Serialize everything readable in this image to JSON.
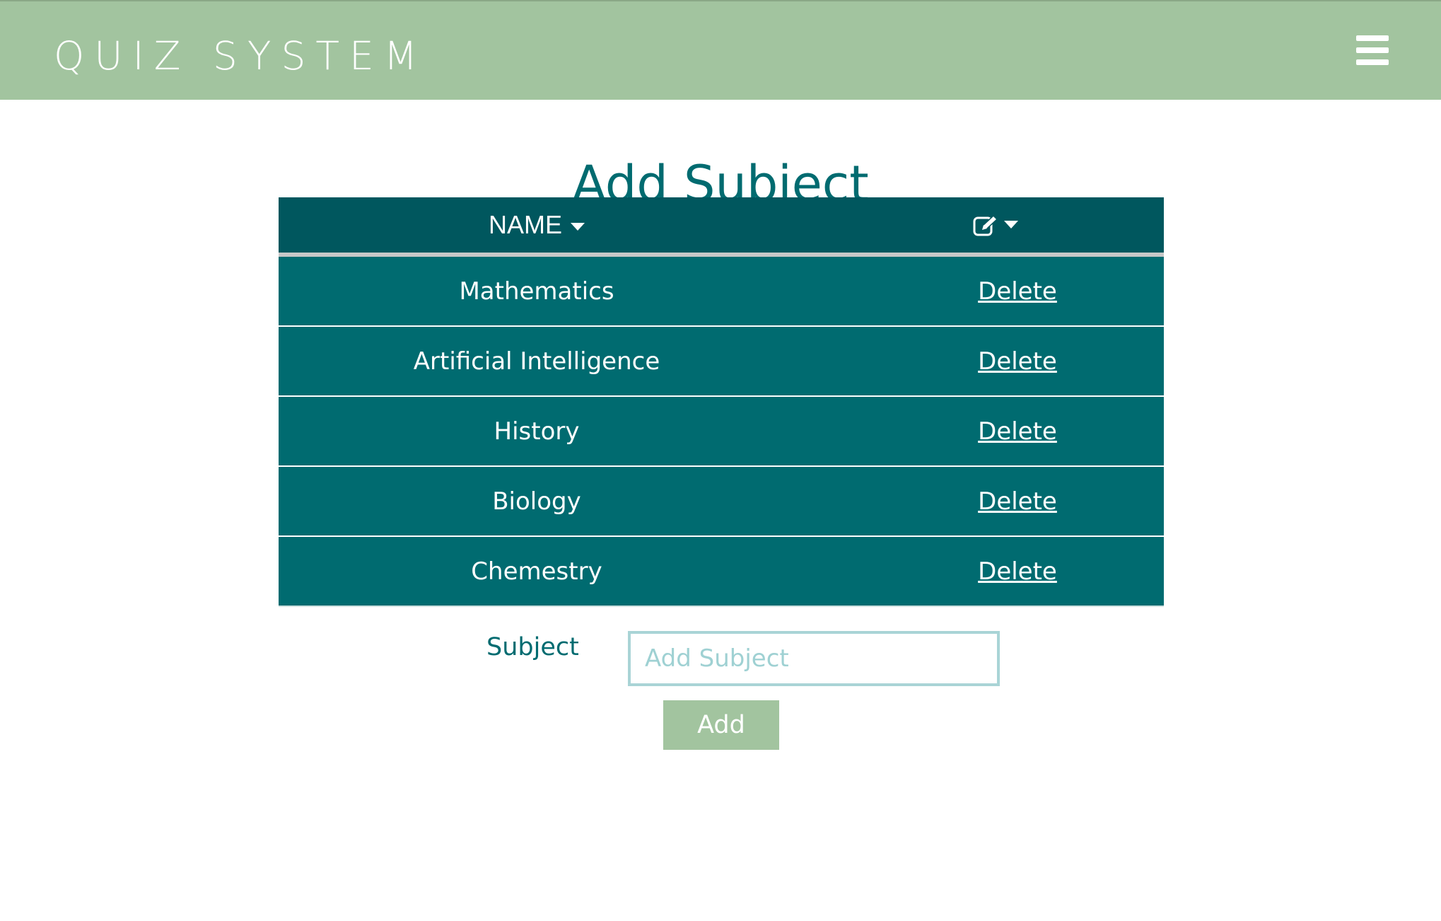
{
  "navbar": {
    "brand": "QUIZ SYSTEM",
    "menu_icon": "hamburger-menu-icon",
    "background": "#a2c49f"
  },
  "page": {
    "title": "Add Subject"
  },
  "table": {
    "header_name": "NAME",
    "header_edit_icon": "edit-icon",
    "header_color": "#00575e",
    "row_color": "#006b70",
    "rows": [
      {
        "name": "Mathematics",
        "action": "Delete"
      },
      {
        "name": "Artificial Intelligence",
        "action": "Delete"
      },
      {
        "name": "History",
        "action": "Delete"
      },
      {
        "name": "Biology",
        "action": "Delete"
      },
      {
        "name": "Chemestry",
        "action": "Delete"
      }
    ]
  },
  "form": {
    "label": "Subject",
    "placeholder": "Add Subject",
    "value": "",
    "submit_label": "Add"
  }
}
